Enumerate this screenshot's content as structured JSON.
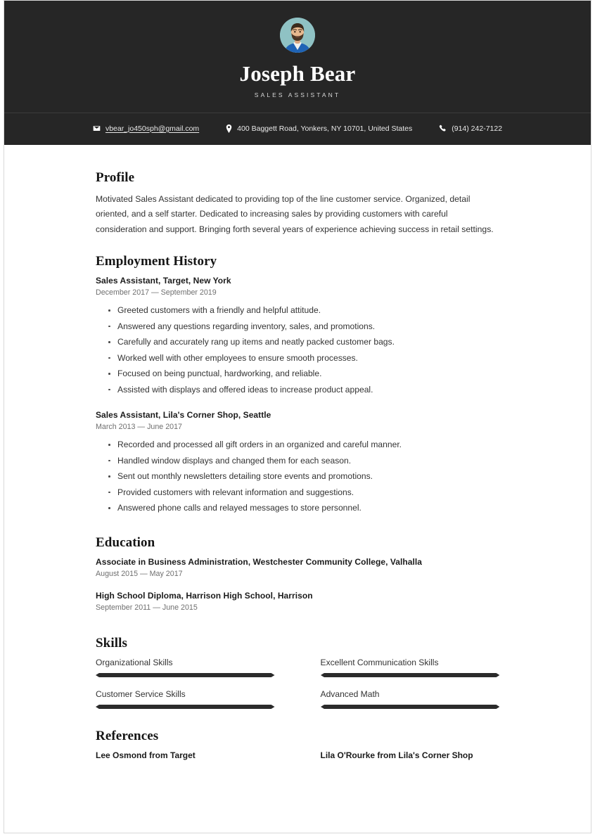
{
  "header": {
    "avatar_alt": "portrait-photo",
    "full_name": "Joseph Bear",
    "job_title": "SALES ASSISTANT"
  },
  "contact": {
    "email_icon": "envelope-icon",
    "email": "vbear_jo450sph@gmail.com",
    "address_icon": "location-pin-icon",
    "address": "400 Baggett Road, Yonkers, NY 10701, United States",
    "phone_icon": "phone-icon",
    "phone": "(914) 242-7122"
  },
  "profile": {
    "heading": "Profile",
    "text": "Motivated Sales Assistant dedicated to providing top of the line customer service. Organized, detail oriented, and a self starter. Dedicated to increasing sales by providing customers with careful consideration and support. Bringing forth several years of experience achieving success in retail settings."
  },
  "employment": {
    "heading": "Employment History",
    "entries": [
      {
        "title": "Sales Assistant, Target, New York",
        "date": "December 2017 — September 2019",
        "bullets": [
          "Greeted customers with a friendly and helpful attitude.",
          "Answered any questions regarding inventory, sales, and promotions.",
          "Carefully and accurately rang up items and neatly packed customer bags.",
          "Worked well with other employees to ensure smooth processes.",
          "Focused on being punctual, hardworking, and reliable.",
          "Assisted with displays and offered ideas to increase product appeal."
        ]
      },
      {
        "title": "Sales Assistant, Lila's Corner Shop, Seattle",
        "date": "March 2013 — June 2017",
        "bullets": [
          "Recorded and processed all gift orders in an organized and careful manner.",
          "Handled window displays and changed them for each season.",
          "Sent out monthly newsletters detailing store events and promotions.",
          "Provided customers with relevant information and suggestions.",
          "Answered phone calls and relayed messages to store personnel."
        ]
      }
    ]
  },
  "education": {
    "heading": "Education",
    "entries": [
      {
        "title": "Associate in Business Administration, Westchester Community College, Valhalla",
        "date": "August 2015 — May 2017"
      },
      {
        "title": "High School Diploma, Harrison High School, Harrison",
        "date": "September 2011 — June 2015"
      }
    ]
  },
  "skills": {
    "heading": "Skills",
    "items": [
      {
        "name": "Organizational Skills",
        "level": 100
      },
      {
        "name": "Excellent Communication Skills",
        "level": 100
      },
      {
        "name": "Customer Service Skills",
        "level": 100
      },
      {
        "name": "Advanced Math",
        "level": 100
      }
    ]
  },
  "references": {
    "heading": "References",
    "items": [
      {
        "name": "Lee Osmond from Target"
      },
      {
        "name": "Lila O'Rourke from Lila's Corner Shop"
      }
    ]
  },
  "colors": {
    "header_bg": "#262626",
    "page_bg": "#ffffff",
    "body_text": "#333333",
    "heading_text": "#151515",
    "muted_text": "#6f6f6f",
    "skill_bar": "#2b2b2b"
  }
}
